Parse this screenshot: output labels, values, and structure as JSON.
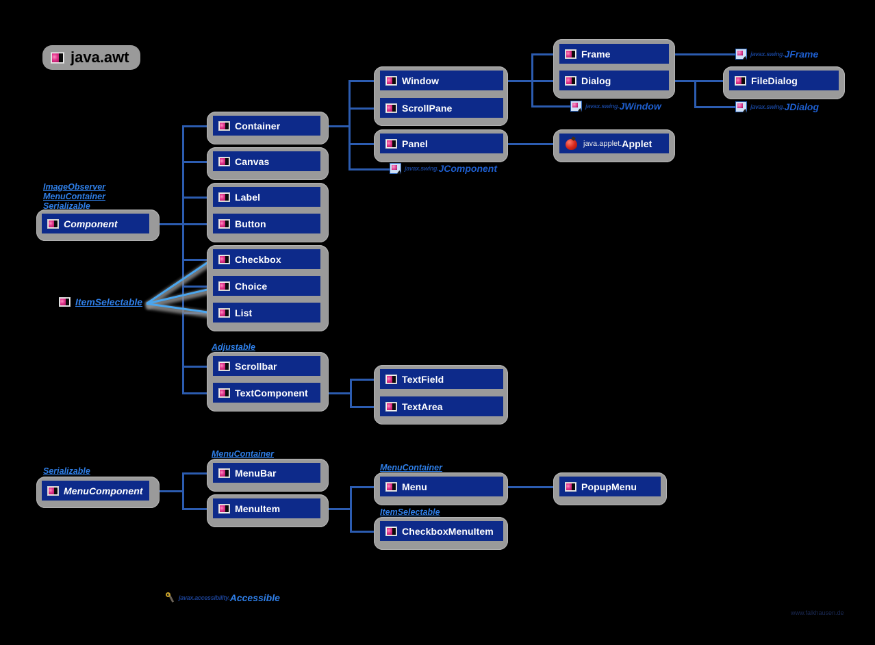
{
  "package": {
    "title": "java.awt",
    "icon": "class-icon"
  },
  "watermark": "www.falkhausen.de",
  "colors": {
    "background": "#000000",
    "class_fill": "#0d2a8a",
    "group_fill": "#9a9a9a",
    "connector": "#2c5cb0",
    "realization": "#4aa6ef",
    "interface_text": "#2f7fe8",
    "class_text": "#ffffff"
  },
  "roots": {
    "component": {
      "name": "Component",
      "abstract": true,
      "interfaces": [
        "ImageObserver",
        "MenuContainer",
        "Serializable"
      ]
    },
    "menucomponent": {
      "name": "MenuComponent",
      "abstract": true,
      "interfaces": [
        "Serializable"
      ]
    }
  },
  "classes": {
    "container": "Container",
    "canvas": "Canvas",
    "label": "Label",
    "button": "Button",
    "checkbox": "Checkbox",
    "choice": "Choice",
    "list": "List",
    "scrollbar": "Scrollbar",
    "textcomponent": "TextComponent",
    "window": "Window",
    "scrollpane": "ScrollPane",
    "panel": "Panel",
    "textfield": "TextField",
    "textarea": "TextArea",
    "frame": "Frame",
    "dialog": "Dialog",
    "filedialog": "FileDialog",
    "menubar": "MenuBar",
    "menuitem": "MenuItem",
    "menu": "Menu",
    "checkboxmenuitem": "CheckboxMenuItem",
    "popupmenu": "PopupMenu"
  },
  "external": {
    "jcomponent": {
      "pkg": "javax.swing.",
      "name": "JComponent"
    },
    "jwindow": {
      "pkg": "javax.swing.",
      "name": "JWindow"
    },
    "jframe": {
      "pkg": "javax.swing.",
      "name": "JFrame"
    },
    "jdialog": {
      "pkg": "javax.swing.",
      "name": "JDialog"
    },
    "applet": {
      "pkg": "java.applet.",
      "name": "Applet"
    },
    "accessible": {
      "pkg": "javax.accessibility.",
      "name": "Accessible"
    }
  },
  "interface_labels": {
    "itemselectable_left": "ItemSelectable",
    "adjustable": "Adjustable",
    "menucontainer_menubar": "MenuContainer",
    "menucontainer_menu": "MenuContainer",
    "itemselectable_menu": "ItemSelectable"
  }
}
